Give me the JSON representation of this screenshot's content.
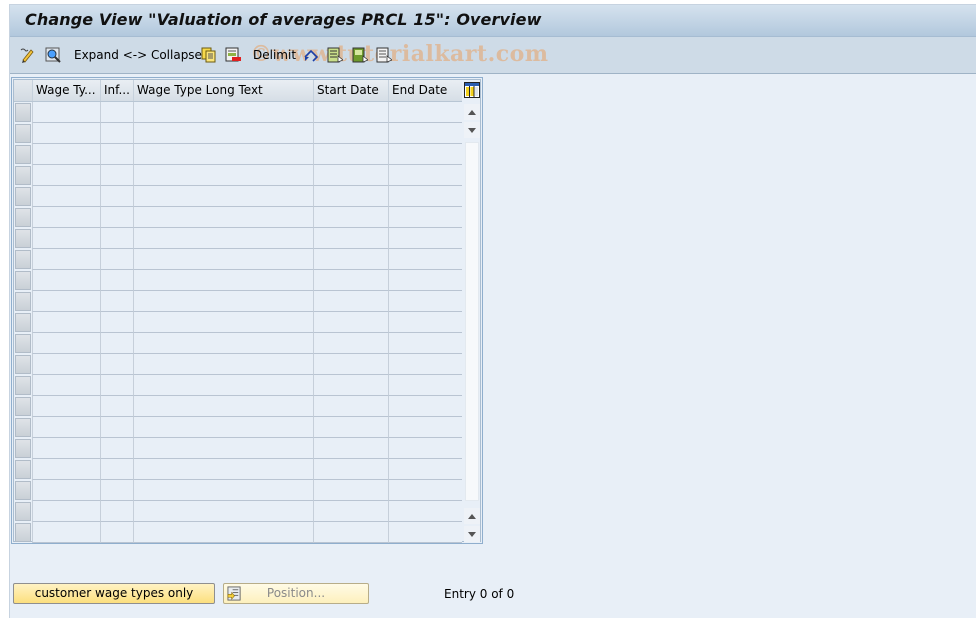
{
  "window": {
    "title": "Change View \"Valuation of averages PRCL 15\": Overview"
  },
  "toolbar": {
    "items": [
      {
        "icon": "display-change-icon",
        "label": ""
      },
      {
        "icon": "details-icon",
        "label": ""
      },
      {
        "icon": "",
        "label": "Expand <-> Collapse"
      },
      {
        "icon": "copy-as-icon",
        "label": ""
      },
      {
        "icon": "delete-icon",
        "label": ""
      },
      {
        "icon": "",
        "label": "Delimit"
      },
      {
        "icon": "undo-change-icon",
        "label": ""
      },
      {
        "icon": "select-all-icon",
        "label": ""
      },
      {
        "icon": "select-block-icon",
        "label": ""
      },
      {
        "icon": "deselect-all-icon",
        "label": ""
      }
    ],
    "expand_collapse_label": "Expand <-> Collapse",
    "delimit_label": "Delimit",
    "watermark": "©www.tutorialkart.com"
  },
  "table": {
    "columns": [
      {
        "key": "wage_type",
        "label": "Wage Ty..."
      },
      {
        "key": "infotype",
        "label": "Inf..."
      },
      {
        "key": "long_text",
        "label": "Wage Type Long Text"
      },
      {
        "key": "start_date",
        "label": "Start Date"
      },
      {
        "key": "end_date",
        "label": "End Date"
      }
    ],
    "row_count_visible": 21,
    "rows": []
  },
  "footer": {
    "customer_button_label": "customer wage types only",
    "position_button_label": "Position...",
    "entry_text": "Entry 0 of 0"
  },
  "colors": {
    "background": "#e8eff7",
    "titlebar": "#b2c8dd",
    "toolbar": "#cedbe7",
    "primary_button": "#fcdf7e"
  }
}
